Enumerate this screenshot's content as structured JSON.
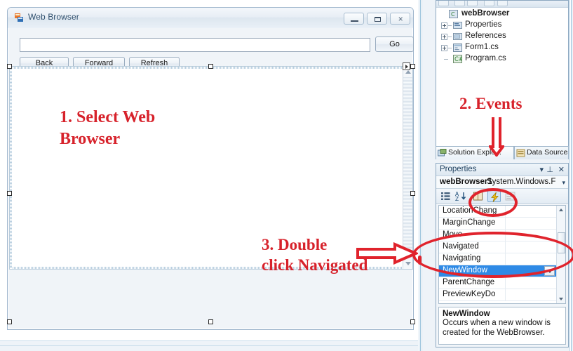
{
  "form": {
    "title": "Web Browser",
    "icon": "form-app-icon",
    "window_buttons": {
      "minimize": "minimize-icon",
      "maximize": "maximize-icon",
      "close": "×"
    },
    "url_value": "",
    "url_placeholder": "",
    "go_label": "Go",
    "buttons": [
      {
        "name": "back",
        "label": "Back"
      },
      {
        "name": "forward",
        "label": "Forward"
      },
      {
        "name": "refresh",
        "label": "Refresh"
      }
    ]
  },
  "annotations": {
    "accent_color": "#d7222b",
    "step1": "1. Select Web\nBrowser",
    "step2": "2. Events",
    "step3": "3. Double\nclick Navigated"
  },
  "solution_explorer": {
    "tree": [
      {
        "label": "webBrowser",
        "icon": "project-csharp-icon",
        "indent": 0,
        "expander": false,
        "root": true
      },
      {
        "label": "Properties",
        "icon": "properties-folder-icon",
        "indent": 1,
        "expander": true,
        "root": false
      },
      {
        "label": "References",
        "icon": "references-folder-icon",
        "indent": 1,
        "expander": true,
        "root": false
      },
      {
        "label": "Form1.cs",
        "icon": "form-file-icon",
        "indent": 1,
        "expander": true,
        "root": false
      },
      {
        "label": "Program.cs",
        "icon": "csharp-file-icon",
        "indent": 1,
        "expander": false,
        "root": false
      }
    ],
    "tabs": [
      {
        "label": "Solution Explo...",
        "icon": "solution-explorer-icon",
        "selected": true
      },
      {
        "label": "Data Sources",
        "icon": "data-sources-icon",
        "selected": false
      }
    ]
  },
  "properties_panel": {
    "title": "Properties",
    "header_controls": {
      "dropdown": "▾",
      "pin": "⊥",
      "close": "✕"
    },
    "object_name": "webBrowser1",
    "object_type": "System.Windows.F",
    "object_caret": "▾",
    "toolbar": [
      {
        "name": "categorized",
        "icon": "categorized-icon",
        "state": "normal"
      },
      {
        "name": "alphabetical",
        "icon": "alphabetical-sort-icon",
        "state": "normal"
      },
      {
        "name": "properties",
        "icon": "properties-book-icon",
        "state": "normal"
      },
      {
        "name": "events",
        "icon": "events-lightning-icon",
        "state": "active"
      },
      {
        "name": "property-pages",
        "icon": "property-pages-icon",
        "state": "disabled"
      }
    ],
    "events": [
      {
        "name": "LocationChang",
        "value": "",
        "selected": false,
        "dropdown": false
      },
      {
        "name": "MarginChange",
        "value": "",
        "selected": false,
        "dropdown": false
      },
      {
        "name": "Move",
        "value": "",
        "selected": false,
        "dropdown": false
      },
      {
        "name": "Navigated",
        "value": "",
        "selected": false,
        "dropdown": false
      },
      {
        "name": "Navigating",
        "value": "",
        "selected": false,
        "dropdown": false
      },
      {
        "name": "NewWindow",
        "value": "",
        "selected": true,
        "dropdown": true
      },
      {
        "name": "ParentChange",
        "value": "",
        "selected": false,
        "dropdown": false
      },
      {
        "name": "PreviewKeyDo",
        "value": "",
        "selected": false,
        "dropdown": false
      }
    ],
    "description": {
      "title": "NewWindow",
      "text": "Occurs when a new window is created for the WebBrowser."
    }
  }
}
